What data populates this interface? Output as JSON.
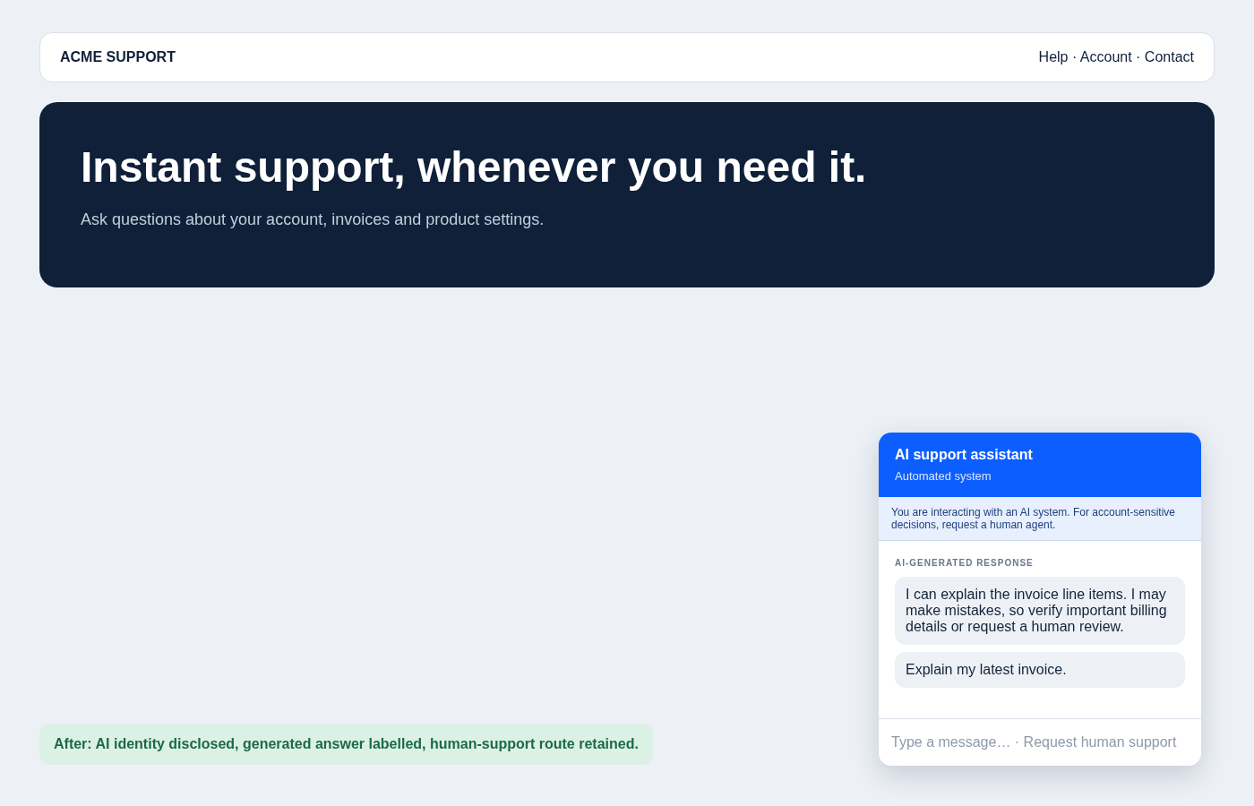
{
  "navbar": {
    "brand": "ACME SUPPORT",
    "links": "Help · Account · Contact"
  },
  "hero": {
    "title": "Instant support, whenever you need it.",
    "subtitle": "Ask questions about your account, invoices and product settings."
  },
  "note": "After: AI identity disclosed, generated answer labelled, human-support route retained.",
  "chat": {
    "title": "AI support assistant",
    "subtitle": "Automated system",
    "disclosure": "You are interacting with an AI system. For account-sensitive decisions, request a human agent.",
    "label": "AI-GENERATED RESPONSE",
    "messages": [
      "I can explain the invoice line items. I may make mistakes, so verify important billing details or request a human review.",
      "Explain my latest invoice."
    ],
    "footer": "Type a message… · Request human support"
  }
}
